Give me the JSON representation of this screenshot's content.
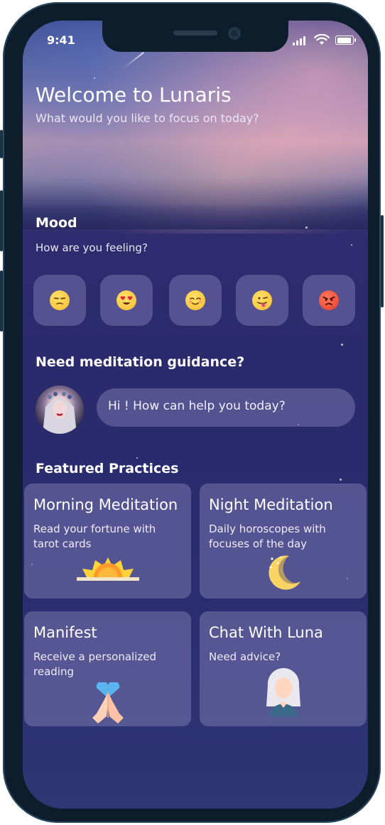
{
  "status_bar": {
    "time": "9:41"
  },
  "header": {
    "title": "Welcome to Lunaris",
    "subtitle": "What would you like to focus on today?"
  },
  "mood": {
    "title": "Mood",
    "subtitle": "How are you feeling?",
    "options": [
      {
        "icon": "unamused-face-icon"
      },
      {
        "icon": "heart-eyes-face-icon"
      },
      {
        "icon": "smiling-blush-face-icon"
      },
      {
        "icon": "tongue-out-face-icon"
      },
      {
        "icon": "angry-face-icon"
      }
    ]
  },
  "guidance": {
    "title": "Need meditation guidance?",
    "chat_prompt": "Hi ! How can help you today?"
  },
  "featured": {
    "title": "Featured Practices",
    "cards": [
      {
        "title": "Morning Meditation",
        "description": "Read your fortune with tarot cards",
        "icon": "sunrise-icon"
      },
      {
        "title": "Night Meditation",
        "description": "Daily horoscopes with focuses of the day",
        "icon": "crescent-moon-icon"
      },
      {
        "title": "Manifest",
        "description": "Receive a personalized reading",
        "icon": "praying-hands-heart-icon"
      },
      {
        "title": "Chat With Luna",
        "description": "Need advice?",
        "icon": "luna-avatar-icon"
      }
    ]
  },
  "colors": {
    "background": "#2a2a6c",
    "card": "#6f6ca8",
    "text": "#ffffff"
  }
}
